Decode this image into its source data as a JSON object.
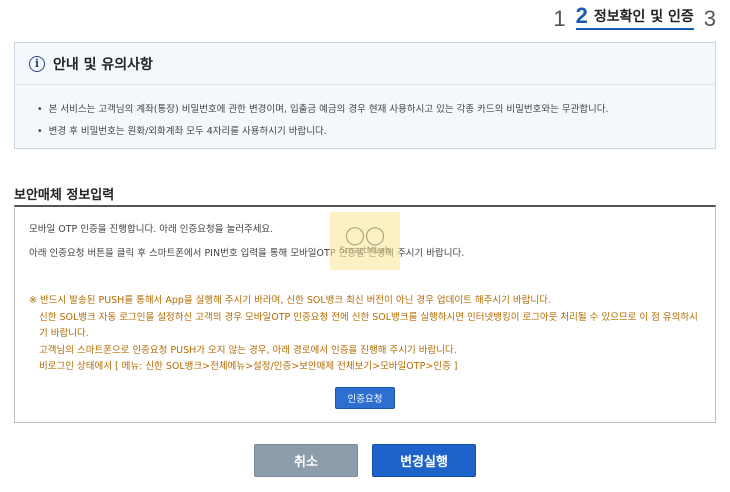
{
  "steps": {
    "step1": "1",
    "step2": "2",
    "step2_label": "정보확인 및 인증",
    "step3": "3"
  },
  "notice": {
    "icon": "info-icon",
    "title": "안내 및 유의사항",
    "items": [
      "본 서비스는 고객님의 계좌(통장) 비밀번호에 관한 변경이며, 입출금 예금의 경우 현재 사용하시고 있는 각종 카드의 비밀번호와는 무관합니다.",
      "변경 후 비밀번호는 원화/외화계좌 모두 4자리를 사용하시기 바랍니다."
    ]
  },
  "security": {
    "title": "보안매체 정보입력",
    "line1": "모바일 OTP 인증을 진행합니다. 아래 인증요청을 눌러주세요.",
    "line2": "아래 인증요청 버튼을 클릭 후 스마트폰에서 PIN번호 입력을 통해 모바일OTP 인증을 진행해 주시기 바랍니다.",
    "warnings": [
      "※ 반드시 발송된 PUSH를 통해서 App을 실행해 주시기 바라며, 신한 SOL뱅크 최신 버전이 아닌 경우 업데이트 해주시기 바랍니다.",
      "신한 SOL뱅크 자동 로그인을 설정하신 고객의 경우 모바일OTP 인증요청 전에 신한 SOL뱅크를 실행하시면 인터넷뱅킹이 로그아웃 처리될 수 있으므로 이 점 유의하시기 바랍니다.",
      "고객님의 스마트폰으로 인증요청 PUSH가 오지 않는 경우, 아래 경로에서 인증을 진행해 주시기 바랍니다.",
      "비로그인 상태에서 [ 메뉴: 신한 SOL뱅크>전체메뉴>설정/인증>보안매체 전체보기>모바일OTP>인증 ]"
    ],
    "auth_button": "인증요청"
  },
  "watermark": {
    "text": "SmartMLab"
  },
  "buttons": {
    "cancel": "취소",
    "execute": "변경실행"
  },
  "colors": {
    "accent": "#1d63c9",
    "warning_text": "#b36b00",
    "cancel_bg": "#8c9cab"
  }
}
